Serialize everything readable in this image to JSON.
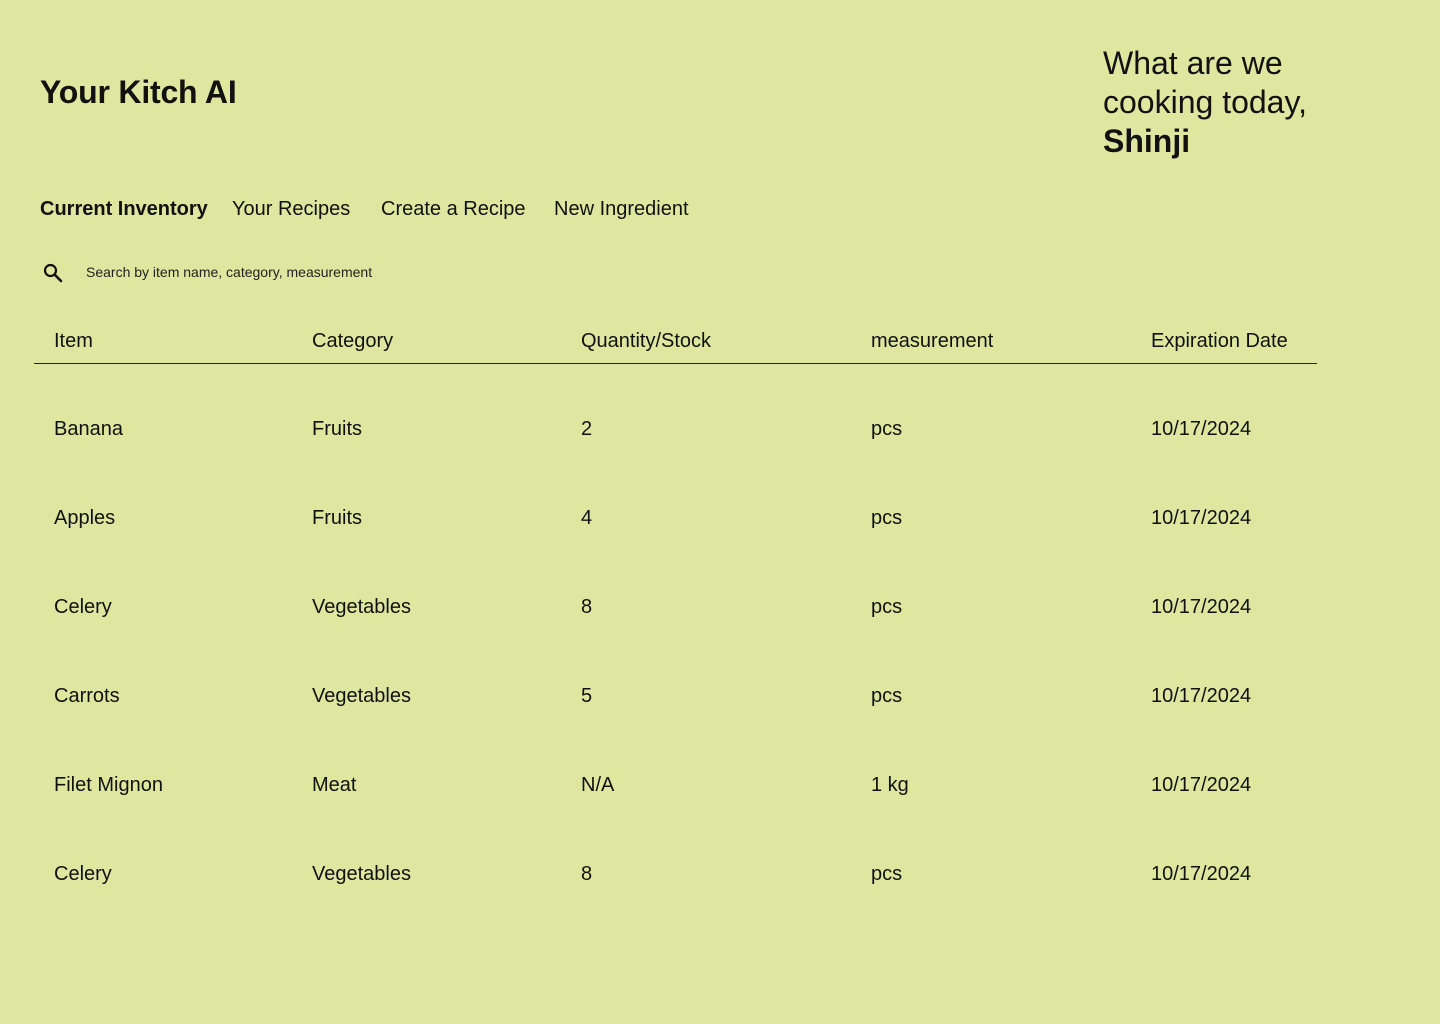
{
  "app": {
    "title": "Your Kitch AI"
  },
  "greeting": {
    "line1": "What are we",
    "line2": "cooking today,",
    "name": "Shinji"
  },
  "nav": {
    "tabs": [
      {
        "label": "Current Inventory",
        "active": true
      },
      {
        "label": "Your Recipes",
        "active": false
      },
      {
        "label": "Create a Recipe",
        "active": false
      },
      {
        "label": "New Ingredient",
        "active": false
      }
    ]
  },
  "search": {
    "icon": "search-icon",
    "placeholder": "Search by item name, category, measurement",
    "value": ""
  },
  "table": {
    "headers": [
      "Item",
      "Category",
      "Quantity/Stock",
      "measurement",
      "Expiration Date"
    ],
    "rows": [
      [
        "Banana",
        "Fruits",
        "2",
        "pcs",
        "10/17/2024"
      ],
      [
        "Apples",
        "Fruits",
        "4",
        "pcs",
        "10/17/2024"
      ],
      [
        "Celery",
        "Vegetables",
        "8",
        "pcs",
        "10/17/2024"
      ],
      [
        "Carrots",
        "Vegetables",
        "5",
        "pcs",
        "10/17/2024"
      ],
      [
        "Filet Mignon",
        "Meat",
        "N/A",
        "1 kg",
        "10/17/2024"
      ],
      [
        "Celery",
        "Vegetables",
        "8",
        "pcs",
        "10/17/2024"
      ]
    ]
  },
  "colors": {
    "background": "#dfe6a0",
    "text": "#111111"
  }
}
